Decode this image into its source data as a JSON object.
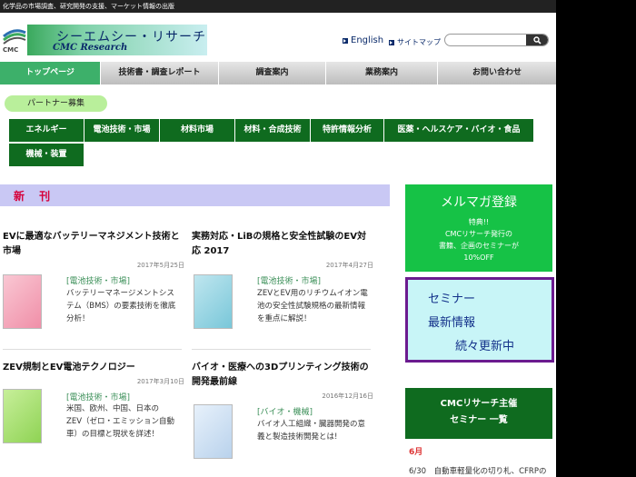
{
  "header": {
    "tagline": "化学品の市場調査、研究開発の支援、マーケット情報の出版",
    "logo_jp": "シーエムシー・リサーチ",
    "logo_en": "CMC Research",
    "english_link": "English",
    "sitemap_link": "サイトマップ",
    "search_placeholder": ""
  },
  "nav": [
    {
      "label": "トップページ",
      "active": true
    },
    {
      "label": "技術書・調査レポート"
    },
    {
      "label": "調査案内"
    },
    {
      "label": "業務案内"
    },
    {
      "label": "お問い合わせ"
    }
  ],
  "partner_button": "パートナー募集",
  "categories": [
    "エネルギー",
    "電池技術・市場",
    "材料市場",
    "材料・合成技術",
    "特許情報分析",
    "医薬・ヘルスケア・バイオ・食品",
    "機械・装置"
  ],
  "new_section_title": "新 刊",
  "articles": [
    {
      "title_1": "EVに最適なバッテリーマネジメント技術と",
      "title_2": "市場",
      "date": "2017年5月25日",
      "category": "[電池技術・市場]",
      "desc_1": "バッテリーマネージメントシス",
      "desc_2": "テム（BMS）の要素技術を徹底",
      "desc_3": "分析！"
    },
    {
      "title_1": "実務対応・LiBの規格と安全性試験のEV対",
      "title_2": "応 2017",
      "date": "2017年4月27日",
      "category": "[電池技術・市場]",
      "desc_1": "ZEVとEV用のリチウムイオン電",
      "desc_2": "池の安全性試験規格の最新情報",
      "desc_3": "を重点に解説！"
    },
    {
      "title_1": "ZEV規制とEV電池テクノロジー",
      "title_2": "",
      "date": "2017年3月10日",
      "category": "[電池技術・市場]",
      "desc_1": "米国、欧州、中国、日本の",
      "desc_2": "ZEV（ゼロ・エミッション自動",
      "desc_3": "車）の目標と現状を詳述！"
    },
    {
      "title_1": "バイオ・医療への3Dプリンティング技術の",
      "title_2": "開発最前線",
      "date": "2016年12月16日",
      "category": "[バイオ・機械]",
      "desc_1": "バイオ人工組織・臓器開発の意",
      "desc_2": "義と製造技術開発とは!",
      "desc_3": ""
    }
  ],
  "sidebar": {
    "mailmag_title": "メルマガ登録",
    "mailmag_line1": "特典!!",
    "mailmag_line2": "CMCリサーチ発行の",
    "mailmag_line3": "書籍、企画のセミナーが",
    "mailmag_line4": "10%OFF",
    "seminar_line1": "セミナー",
    "seminar_line2": "最新情報",
    "seminar_line3": "続々更新中",
    "hosted_line1": "CMCリサーチ主催",
    "hosted_line2": "セミナー 一覧",
    "month": "6月",
    "seminar_item": "6/30　自動車軽量化の切り札、CFRPの"
  },
  "colors": {
    "nav_active": "#3db06a",
    "category_bg": "#0f6b1f",
    "new_header_bg": "#c9c8f4",
    "mailmag_bg": "#16c246",
    "seminar_bg": "#c8f5f7",
    "seminar_border": "#6b1b8f"
  }
}
